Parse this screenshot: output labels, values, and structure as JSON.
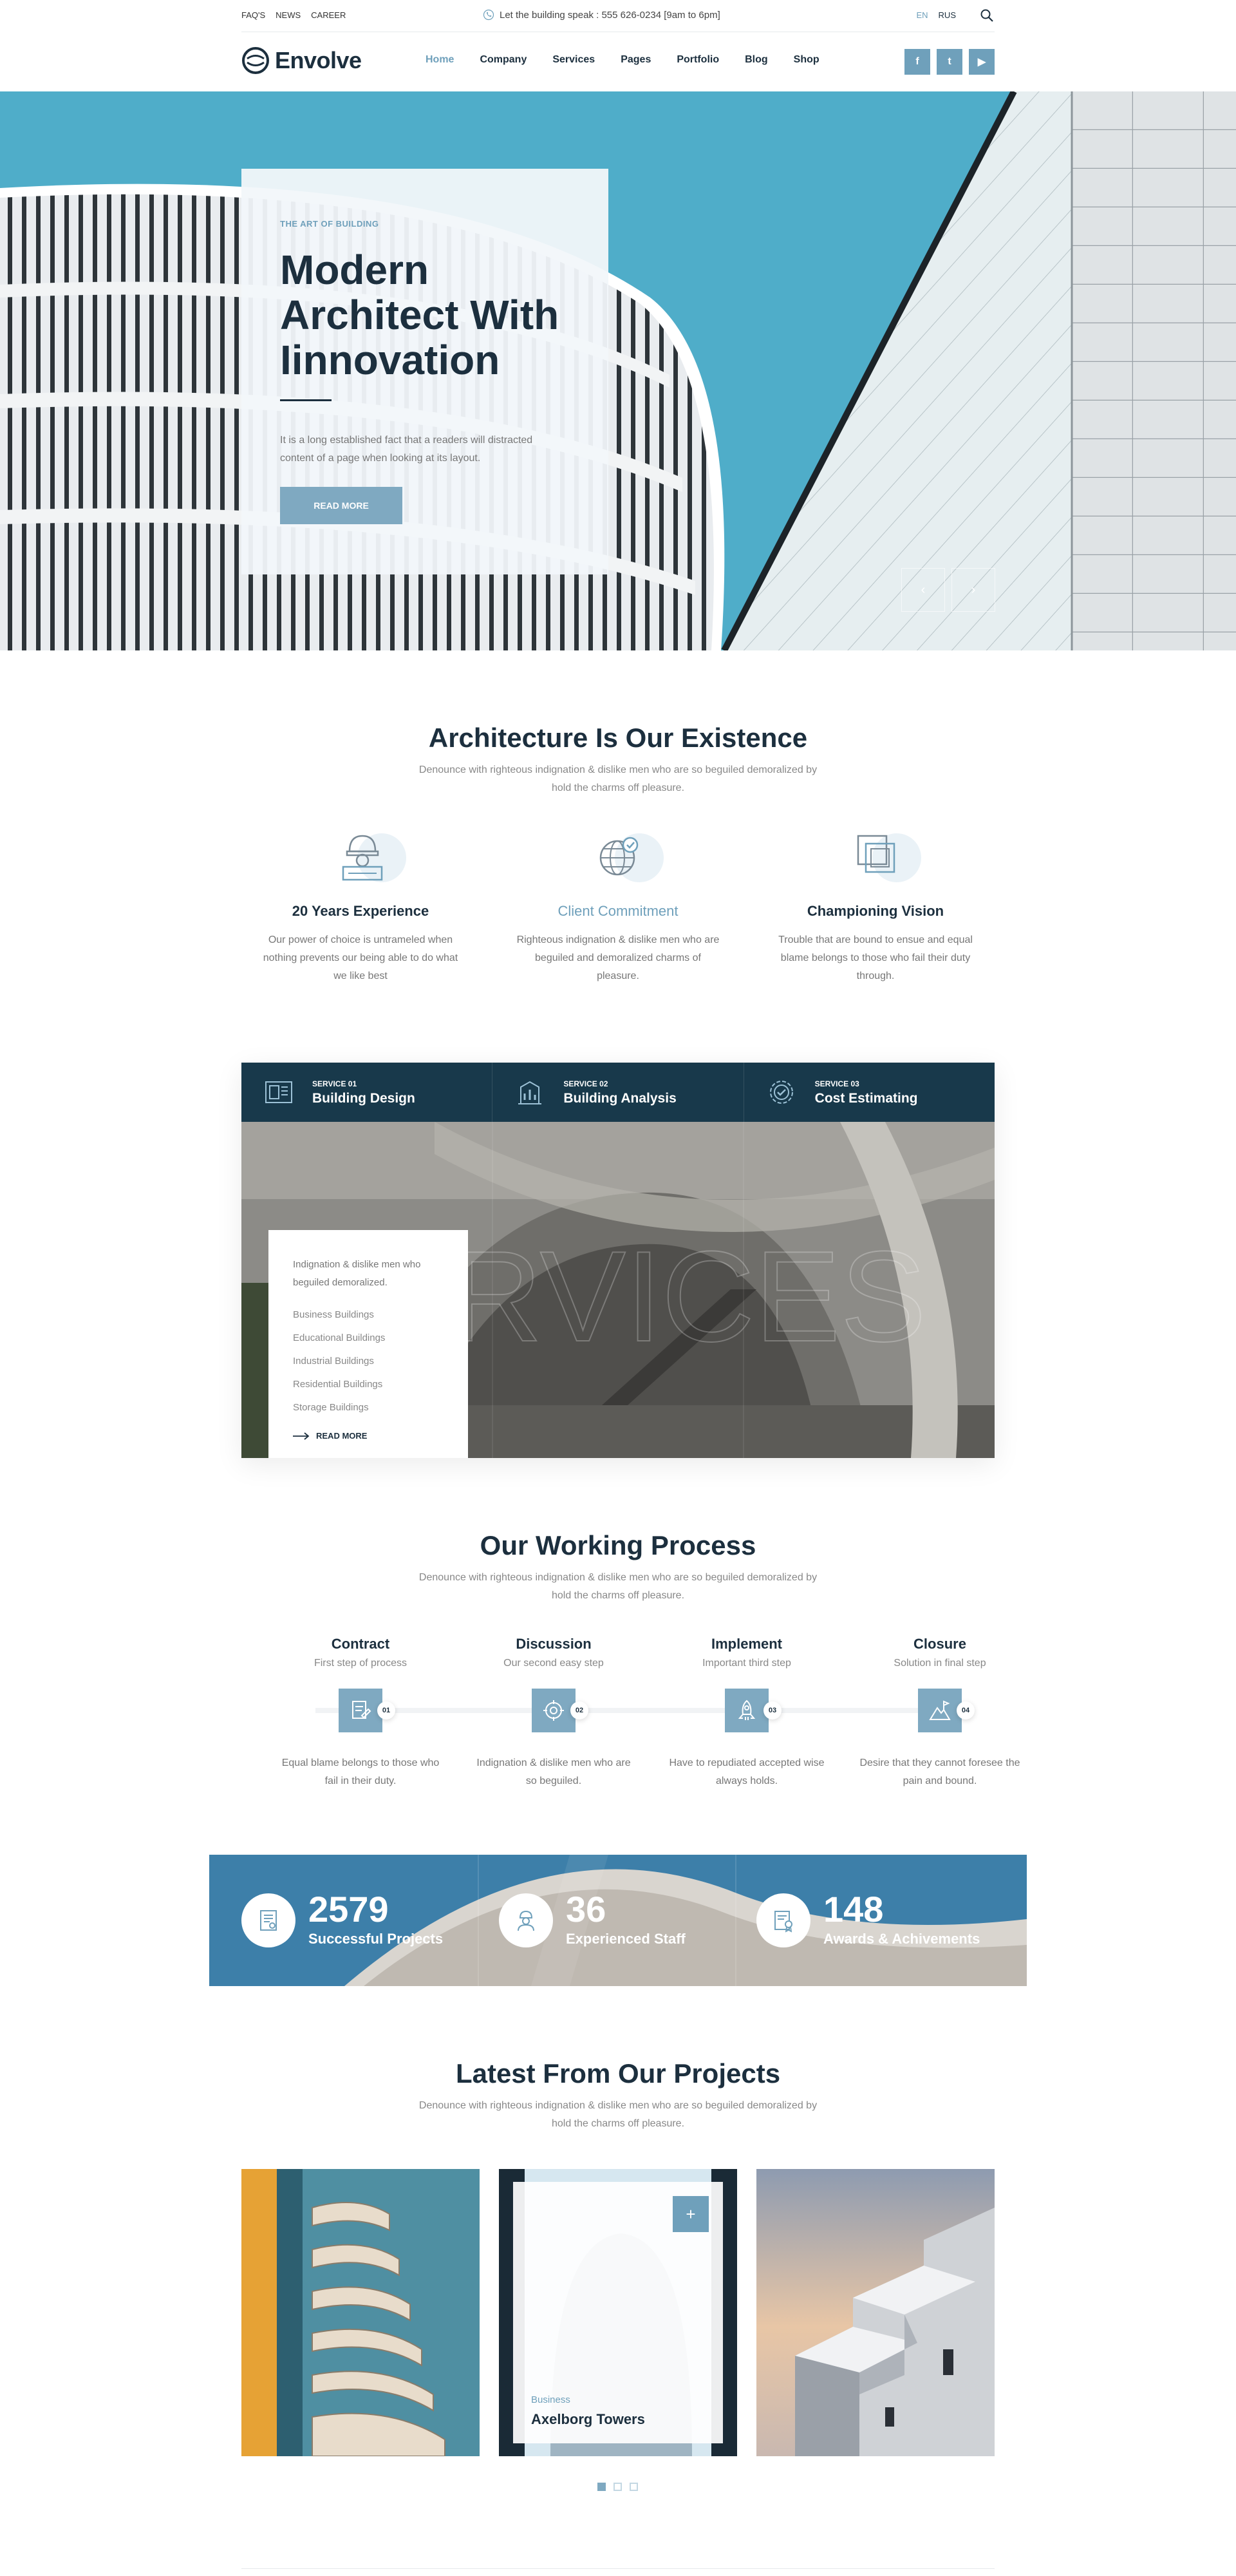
{
  "topbar": {
    "links": [
      "FAQ'S",
      "NEWS",
      "CAREER"
    ],
    "phone_text": "Let the building speak : 555 626-0234  [9am to 6pm]",
    "languages": [
      "EN",
      "RUS"
    ]
  },
  "nav": {
    "logo_text": "Envolve",
    "menu": [
      "Home",
      "Company",
      "Services",
      "Pages",
      "Portfolio",
      "Blog",
      "Shop"
    ],
    "social": [
      {
        "icon": "facebook-icon",
        "glyph": "f"
      },
      {
        "icon": "twitter-icon",
        "glyph": "t"
      },
      {
        "icon": "youtube-icon",
        "glyph": "▶"
      }
    ]
  },
  "hero": {
    "kicker": "THE ART OF BUILDING",
    "title": "Modern Architect With Iinnovation",
    "text": "It is a long established fact that a readers will distracted content of a page when looking at its layout.",
    "button": "READ MORE",
    "prev_glyph": "‹",
    "next_glyph": "›"
  },
  "existence": {
    "title": "Architecture Is Our Existence",
    "subtitle": "Denounce with righteous indignation & dislike men who are so beguiled demoralized by hold the charms off pleasure.",
    "features": [
      {
        "icon": "engineer-icon",
        "title": "20 Years Experience",
        "text": "Our power of choice is untrameled when nothing prevents our being able to do what we like best"
      },
      {
        "icon": "globe-check-icon",
        "title": "Client Commitment",
        "text": "Righteous indignation & dislike men who are beguiled and demoralized charms of pleasure."
      },
      {
        "icon": "layers-icon",
        "title": "Championing  Vision",
        "text": "Trouble that are bound to ensue and equal blame belongs to those who fail their duty through."
      }
    ]
  },
  "services": {
    "tabs": [
      {
        "icon": "blueprint-icon",
        "number": "SERVICE 01",
        "name": "Building Design"
      },
      {
        "icon": "analysis-icon",
        "number": "SERVICE 02",
        "name": "Building Analysis"
      },
      {
        "icon": "estimate-badge-icon",
        "number": "SERVICE 03",
        "name": "Cost Estimating"
      }
    ],
    "watermark": "SERVICES",
    "card": {
      "intro": "Indignation & dislike men who beguiled demoralized.",
      "items": [
        "Business Buildings",
        "Educational Buildings",
        "Industrial Buildings",
        "Residential Buildings",
        "Storage Buildings"
      ],
      "more": "READ MORE"
    }
  },
  "process": {
    "title": "Our Working Process",
    "subtitle": "Denounce with righteous indignation & dislike men who are so beguiled demoralized by hold the charms off pleasure.",
    "steps": [
      {
        "title": "Contract",
        "sub": "First step of process",
        "badge": "01",
        "icon": "contract-icon",
        "text": "Equal blame belongs to those who fail in their duty."
      },
      {
        "title": "Discussion",
        "sub": "Our second easy step",
        "badge": "02",
        "icon": "discussion-icon",
        "text": "Indignation & dislike men who are so beguiled."
      },
      {
        "title": "Implement",
        "sub": "Important third step",
        "badge": "03",
        "icon": "rocket-icon",
        "text": "Have to repudiated accepted wise always holds."
      },
      {
        "title": "Closure",
        "sub": "Solution in final step",
        "badge": "04",
        "icon": "mountain-flag-icon",
        "text": "Desire that they cannot foresee the pain and bound."
      }
    ]
  },
  "counters": [
    {
      "icon": "certificate-icon",
      "number": "2579",
      "label": "Successful Projects"
    },
    {
      "icon": "staff-icon",
      "number": "36",
      "label": "Experienced Staff"
    },
    {
      "icon": "award-icon",
      "number": "148",
      "label": "Awards & Achivements"
    }
  ],
  "projects": {
    "title": "Latest From Our Projects",
    "subtitle": "Denounce with righteous indignation & dislike men who are so beguiled demoralized by hold the charms off pleasure.",
    "featured": {
      "category": "Business",
      "name": "Axelborg Towers",
      "plus": "+"
    }
  },
  "colors": {
    "accent": "#6fa0bb",
    "navy": "#18394b",
    "text": "#1c2f3e"
  }
}
